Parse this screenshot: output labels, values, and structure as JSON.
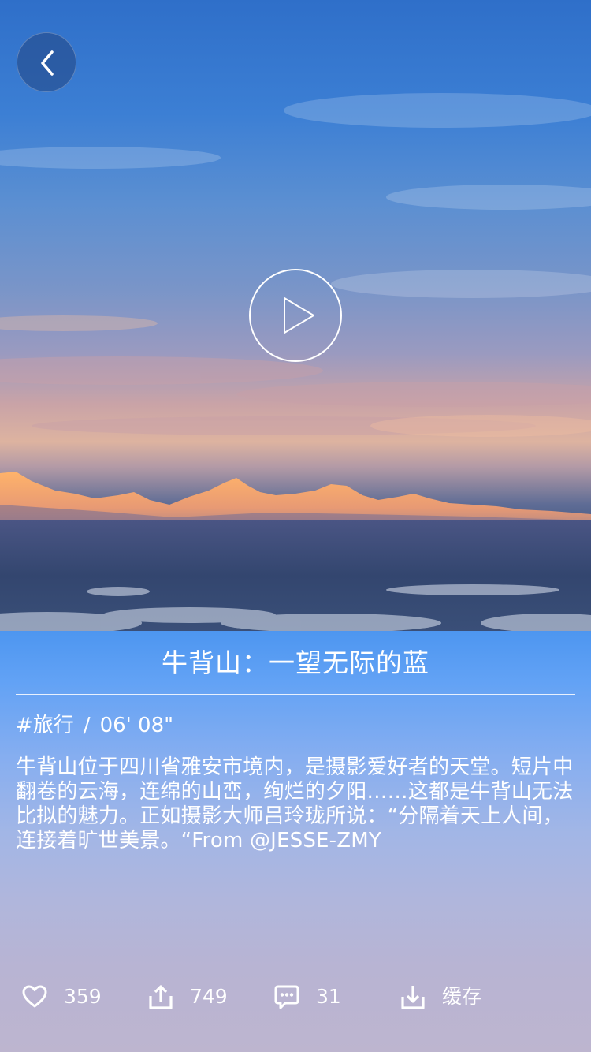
{
  "video": {
    "title": "牛背山：一望无际的蓝",
    "category": "#旅行",
    "separator": "/",
    "duration": "06' 08\"",
    "description": "牛背山位于四川省雅安市境内，是摄影爱好者的天堂。短片中翻卷的云海，连绵的山峦，绚烂的夕阳……这都是牛背山无法比拟的魅力。正如摄影大师吕玲珑所说：“分隔着天上人间，连接着旷世美景。“From @JESSE-ZMY"
  },
  "nav": {
    "back_icon": "chevron-left-icon"
  },
  "player": {
    "play_icon": "play-icon"
  },
  "actions": {
    "like": {
      "icon": "heart-icon",
      "label": "359"
    },
    "share": {
      "icon": "share-upload-icon",
      "label": "749"
    },
    "comment": {
      "icon": "comment-icon",
      "label": "31"
    },
    "download": {
      "icon": "download-icon",
      "label": "缓存"
    }
  },
  "colors": {
    "sky_top": "#2f6fc9",
    "panel_top": "#4d96f0",
    "panel_bottom": "#bdb5cf",
    "text": "#ffffff"
  }
}
